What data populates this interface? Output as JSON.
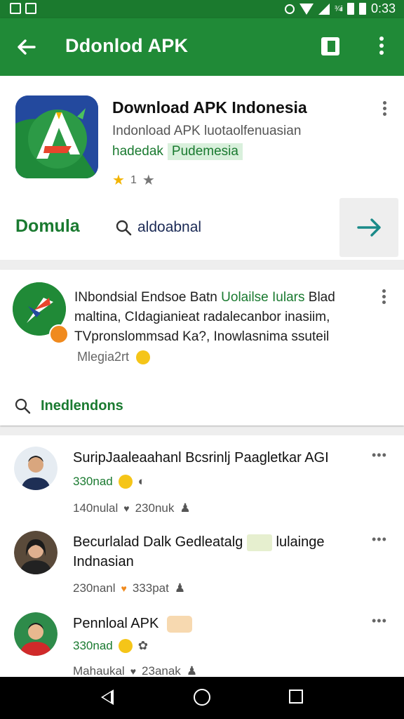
{
  "status_bar": {
    "time": "0:33",
    "bars_label": "¾ii"
  },
  "app_bar": {
    "title": "Ddonlod APK"
  },
  "app": {
    "name": "Download APK Indonesia",
    "subtitle": "Indonload APK luotaolfenuasian",
    "developer": "hadedak",
    "tag": "Pudemesia",
    "rating_count": "1"
  },
  "actions": {
    "download_label": "Domula",
    "search_label": "aldoabnal"
  },
  "post": {
    "title_black": "INbondsial Endsoe Batn",
    "title_green": "Uolailse Iulars",
    "title_end": "Blad",
    "line2": "maltina,  CIdagianieat radalecanbor inasiim,",
    "line3": "TVpronslommsad Ka?, Inowlasnima ssuteil",
    "meta": "Mlegia2rt",
    "link_label": "Inedlendons"
  },
  "feed": [
    {
      "name": "SuripJaaleaahanl Bcsrinlj Paagletkar AGI",
      "likes": "330nad",
      "stat1": "140nulal",
      "stat2": "230nuk"
    },
    {
      "name": "Becurlalad Dalk Gedleatalg",
      "name_end": "lulainge",
      "name_line2": "Indnasian",
      "stat1": "230nanl",
      "stat2": "333pat"
    },
    {
      "name": "Pennloal APK",
      "likes": "330nad",
      "stat1": "Mahaukal",
      "stat2": "23anak"
    }
  ],
  "colors": {
    "primary": "#208a37",
    "status": "#1b7a2e",
    "accent_green": "#1a7a30",
    "badge_orange": "#f08a1e"
  }
}
